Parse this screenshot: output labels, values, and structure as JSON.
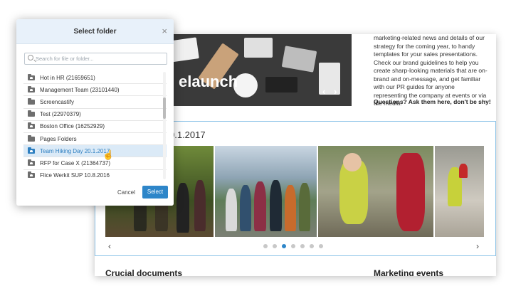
{
  "modal": {
    "title": "Select folder",
    "close_glyph": "×",
    "search_placeholder": "Search for file or folder...",
    "folders": [
      {
        "name": "Hot in HR (21659651)",
        "icon": "shared-folder-icon",
        "selected": false
      },
      {
        "name": "Management Team (23101440)",
        "icon": "shared-folder-icon",
        "selected": false
      },
      {
        "name": "Screencastify",
        "icon": "folder-icon",
        "selected": false
      },
      {
        "name": "Test (22970379)",
        "icon": "folder-icon",
        "selected": false
      },
      {
        "name": "Boston Office (16252929)",
        "icon": "shared-folder-icon",
        "selected": false
      },
      {
        "name": "Pages Folders",
        "icon": "folder-icon",
        "selected": false
      },
      {
        "name": "Team Hiking Day 20.1.2017",
        "icon": "shared-folder-icon",
        "selected": true
      },
      {
        "name": "RFP for Case X (21364737)",
        "icon": "shared-folder-icon",
        "selected": false
      },
      {
        "name": "Flice Werkit SUP 10.8.2016",
        "icon": "shared-folder-icon",
        "selected": false
      }
    ],
    "cancel_label": "Cancel",
    "select_label": "Select",
    "accent_color": "#2e86c9"
  },
  "background_page": {
    "hero_title": "elaunch",
    "hero_prev": "‹",
    "hero_next": "›",
    "side_text": "marketing-related news and details of our strategy for the coming year, to handy templates for your sales presentations. Check our brand guidelines to help you create sharp-looking materials that are on-brand and on-message, and get familiar with our PR guides for anyone representing the company at events or via the media.",
    "side_question": "Questions? Ask them here, don't be shy!",
    "gallery_title": "0.1.2017",
    "gallery_prev": "‹",
    "gallery_next": "›",
    "gallery_dots": 7,
    "gallery_active_dot": 3,
    "section_left": "Crucial documents",
    "section_right": "Marketing events"
  }
}
